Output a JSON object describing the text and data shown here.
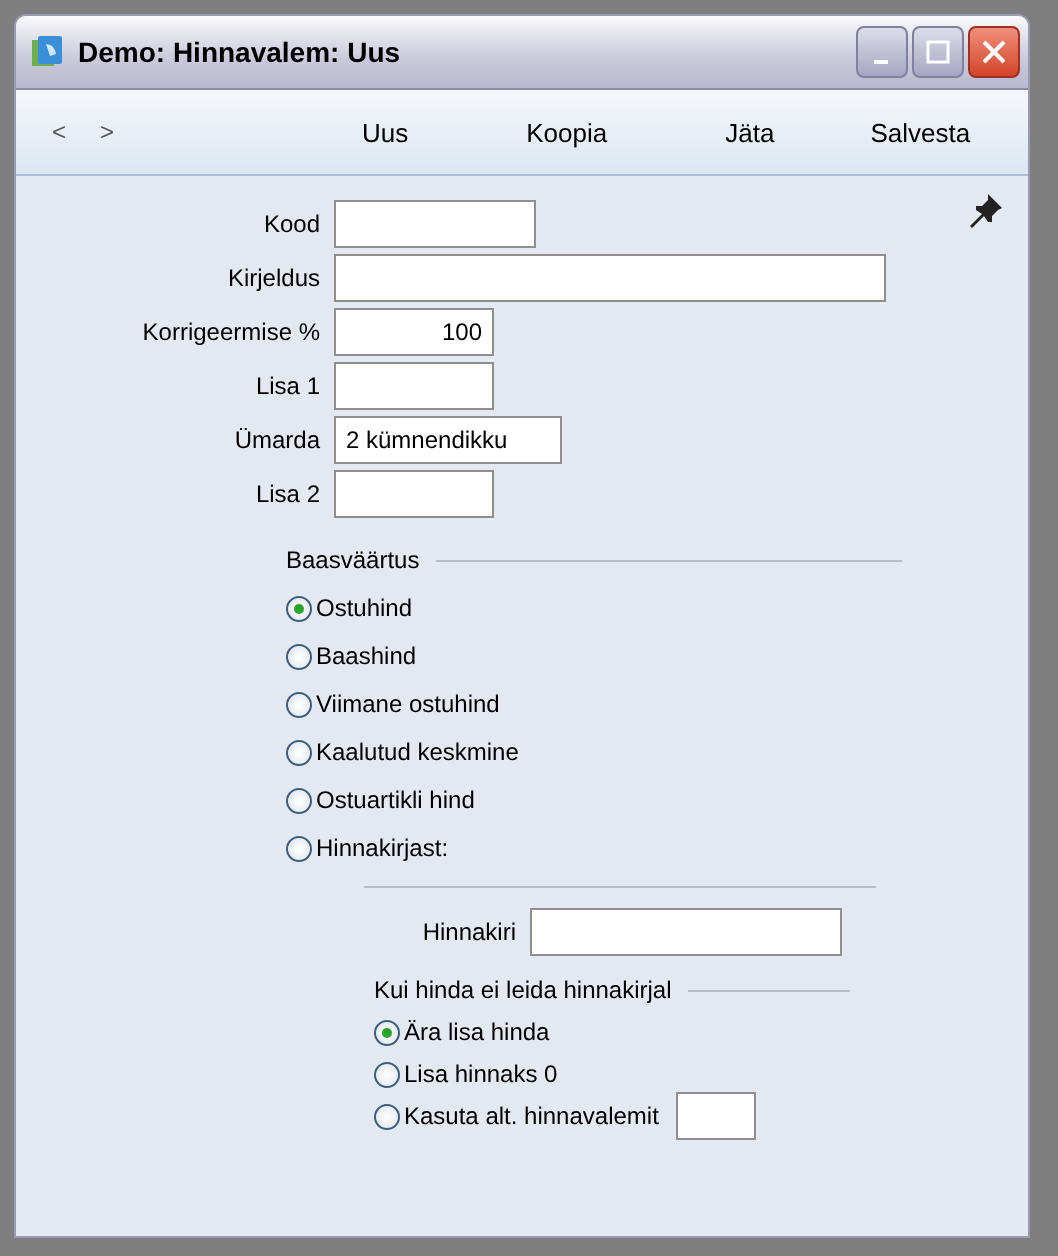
{
  "window": {
    "title": "Demo: Hinnavalem: Uus"
  },
  "toolbar": {
    "nav": [
      "<",
      ">"
    ],
    "buttons": [
      "Uus",
      "Koopia",
      "Jäta",
      "Salvesta"
    ]
  },
  "fields": [
    {
      "label": "Kood",
      "kind": "text"
    },
    {
      "label": "Kirjeldus",
      "kind": "text"
    },
    {
      "label": "Korrigeermise %",
      "value": "100",
      "kind": "number"
    },
    {
      "label": "Lisa 1",
      "kind": "text"
    },
    {
      "label": "Ümarda",
      "value": "2 kümnendikku",
      "kind": "text"
    },
    {
      "label": "Lisa 2",
      "kind": "text"
    }
  ],
  "base_group": {
    "title": "Baasväärtus",
    "options": [
      {
        "label": "Ostuhind",
        "selected": true
      },
      {
        "label": "Baashind",
        "selected": false
      },
      {
        "label": "Viimane ostuhind",
        "selected": false
      },
      {
        "label": "Kaalutud keskmine",
        "selected": false
      },
      {
        "label": "Ostuartikli hind",
        "selected": false
      },
      {
        "label": "Hinnakirjast:",
        "selected": false
      }
    ]
  },
  "price_list": {
    "label": "Hinnakiri"
  },
  "fallback_group": {
    "title": "Kui hinda ei leida hinnakirjal",
    "options": [
      {
        "label": "Ära lisa hinda",
        "selected": true,
        "kind": "plain"
      },
      {
        "label": "Lisa hinnaks 0",
        "selected": false,
        "kind": "plain"
      },
      {
        "label": "Kasuta alt. hinnavalemit",
        "selected": false,
        "kind": "with_field"
      }
    ]
  }
}
